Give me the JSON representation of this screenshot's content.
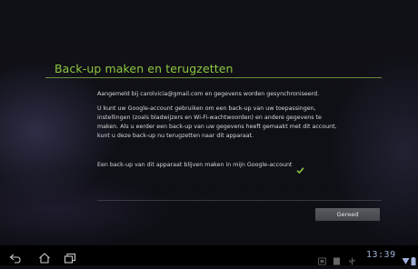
{
  "setup": {
    "title": "Back-up maken en terugzetten",
    "account_line": "Aangemeld bij carolvicia@gmail.com en gegevens worden gesynchroniseerd.",
    "description": "U kunt uw Google-account gebruiken om een back-up van uw toepassingen, instellingen (zoals bladwijzers en Wi-Fi-wachtwoorden) en andere gegevens te maken. Als u eerder een back-up van uw gegevens heeft gemaakt met dit account, kunt u deze back-up nu terugzetten naar dit apparaat.",
    "backup_checkbox": {
      "label": "Een back-up van dit apparaat blijven maken in mijn Google-account",
      "checked": true
    },
    "done_label": "Gereed"
  },
  "navbar": {
    "buttons": [
      "back-icon",
      "home-icon",
      "recent-apps-icon"
    ],
    "status_icons": [
      "screenshot-icon",
      "notification-icon",
      "usb-icon",
      "wifi-icon",
      "battery-icon"
    ],
    "clock": "13:39"
  },
  "colors": {
    "accent": "#8ec63f",
    "status": "#9fb0d8"
  }
}
